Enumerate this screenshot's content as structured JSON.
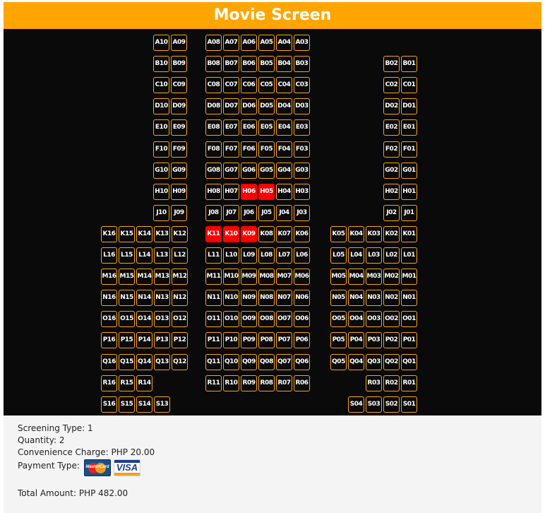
{
  "header": {
    "title": "Movie Screen"
  },
  "seat_rows": [
    {
      "row": "A",
      "left": [],
      "center": [
        "A10",
        "A09"
      ],
      "right_mid": [
        "A08",
        "A07",
        "A06",
        "A05",
        "A04",
        "A03"
      ],
      "right": []
    },
    {
      "row": "B",
      "left": [],
      "center": [
        "B10",
        "B09"
      ],
      "right_mid": [
        "B08",
        "B07",
        "B06",
        "B05",
        "B04",
        "B03"
      ],
      "right": [
        "B02",
        "B01"
      ]
    },
    {
      "row": "C",
      "left": [],
      "center": [
        "C10",
        "C09"
      ],
      "right_mid": [
        "C08",
        "C07",
        "C06",
        "C05",
        "C04",
        "C03"
      ],
      "right": [
        "C02",
        "C01"
      ]
    },
    {
      "row": "D",
      "left": [],
      "center": [
        "D10",
        "D09"
      ],
      "right_mid": [
        "D08",
        "D07",
        "D06",
        "D05",
        "D04",
        "D03"
      ],
      "right": [
        "D02",
        "D01"
      ]
    },
    {
      "row": "E",
      "left": [],
      "center": [
        "E10",
        "E09"
      ],
      "right_mid": [
        "E08",
        "E07",
        "E06",
        "E05",
        "E04",
        "E03"
      ],
      "right": [
        "E02",
        "E01"
      ]
    },
    {
      "row": "F",
      "left": [],
      "center": [
        "F10",
        "F09"
      ],
      "right_mid": [
        "F08",
        "F07",
        "F06",
        "F05",
        "F04",
        "F03"
      ],
      "right": [
        "F02",
        "F01"
      ]
    },
    {
      "row": "G",
      "left": [],
      "center": [
        "G10",
        "G09"
      ],
      "right_mid": [
        "G08",
        "G07",
        "G06",
        "G05",
        "G04",
        "G03"
      ],
      "right": [
        "G02",
        "G01"
      ]
    },
    {
      "row": "H",
      "left": [],
      "center": [
        "H10",
        "H09"
      ],
      "right_mid": [
        "H08",
        "H07",
        "H06",
        "H05",
        "H04",
        "H03"
      ],
      "right": [
        "H02",
        "H01"
      ]
    },
    {
      "row": "J",
      "left": [],
      "center": [
        "J10",
        "J09"
      ],
      "right_mid": [
        "J08",
        "J07",
        "J06",
        "J05",
        "J04",
        "J03"
      ],
      "right": [
        "J02",
        "J01"
      ]
    },
    {
      "row": "K",
      "left": [
        "K16",
        "K15",
        "K14",
        "K13",
        "K12"
      ],
      "center": [],
      "right_mid": [
        "K11",
        "K10",
        "K09",
        "K08",
        "K07",
        "K06"
      ],
      "right": [
        "K05",
        "K04",
        "K03",
        "K02",
        "K01"
      ]
    },
    {
      "row": "L",
      "left": [
        "L16",
        "L15",
        "L14",
        "L13",
        "L12"
      ],
      "center": [],
      "right_mid": [
        "L11",
        "L10",
        "L09",
        "L08",
        "L07",
        "L06"
      ],
      "right": [
        "L05",
        "L04",
        "L03",
        "L02",
        "L01"
      ]
    },
    {
      "row": "M",
      "left": [
        "M16",
        "M15",
        "M14",
        "M13",
        "M12"
      ],
      "center": [],
      "right_mid": [
        "M11",
        "M10",
        "M09",
        "M08",
        "M07",
        "M06"
      ],
      "right": [
        "M05",
        "M04",
        "M03",
        "M02",
        "M01"
      ]
    },
    {
      "row": "N",
      "left": [
        "N16",
        "N15",
        "N14",
        "N13",
        "N12"
      ],
      "center": [],
      "right_mid": [
        "N11",
        "N10",
        "N09",
        "N08",
        "N07",
        "N06"
      ],
      "right": [
        "N05",
        "N04",
        "N03",
        "N02",
        "N01"
      ]
    },
    {
      "row": "O",
      "left": [
        "O16",
        "O15",
        "O14",
        "O13",
        "O12"
      ],
      "center": [],
      "right_mid": [
        "O11",
        "O10",
        "O09",
        "O08",
        "O07",
        "O06"
      ],
      "right": [
        "O05",
        "O04",
        "O03",
        "O02",
        "O01"
      ]
    },
    {
      "row": "P",
      "left": [
        "P16",
        "P15",
        "P14",
        "P13",
        "P12"
      ],
      "center": [],
      "right_mid": [
        "P11",
        "P10",
        "P09",
        "P08",
        "P07",
        "P06"
      ],
      "right": [
        "P05",
        "P04",
        "P03",
        "P02",
        "P01"
      ]
    },
    {
      "row": "Q",
      "left": [
        "Q16",
        "Q15",
        "Q14",
        "Q13",
        "Q12"
      ],
      "center": [],
      "right_mid": [
        "Q11",
        "Q10",
        "Q09",
        "Q08",
        "Q07",
        "Q06"
      ],
      "right": [
        "Q05",
        "Q04",
        "Q03",
        "Q02",
        "Q01"
      ]
    },
    {
      "row": "R",
      "left": [
        "R16",
        "R15",
        "R14"
      ],
      "center": [],
      "right_mid": [
        "R11",
        "R10",
        "R09",
        "R08",
        "R07",
        "R06"
      ],
      "right": [
        "R03",
        "R02",
        "R01"
      ]
    },
    {
      "row": "S",
      "left": [
        "S16",
        "S15",
        "S14",
        "S13"
      ],
      "center": [],
      "right_mid": [],
      "right": [
        "S04",
        "S03",
        "S02",
        "S01"
      ]
    }
  ],
  "selected_seats": [
    "H06",
    "H05",
    "K11",
    "K10",
    "K09"
  ],
  "colors": {
    "accent": "#FFA500",
    "seat_bg": "#0a0a0a",
    "seat_selected": "#FF0000",
    "panel_bg": "#f4f4f4"
  },
  "summary": {
    "screening_type": "Screening Type: 1",
    "quantity": "Quantity: 2",
    "convenience_charge": "Convenience Charge: PHP 20.00",
    "payment_type_label": "Payment Type:",
    "payment_methods": [
      {
        "name": "MasterCard",
        "icon": "mastercard-icon"
      },
      {
        "name": "VISA",
        "icon": "visa-icon"
      }
    ],
    "total_amount": "Total Amount: PHP 482.00"
  }
}
